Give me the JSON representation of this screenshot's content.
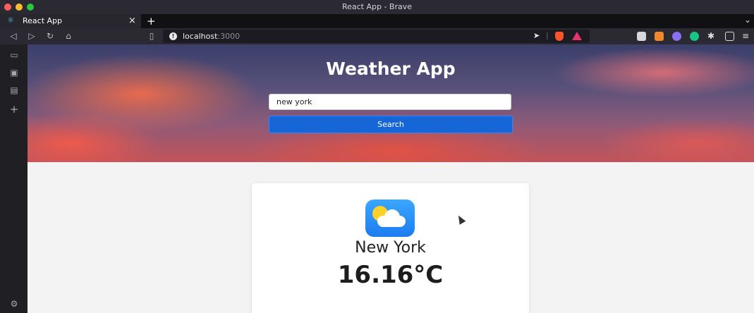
{
  "window": {
    "title": "React App - Brave"
  },
  "tabs": [
    {
      "label": "React App",
      "icon": "react-icon"
    }
  ],
  "toolbar": {
    "url_host": "localhost",
    "url_port": ":3000",
    "icons": [
      "back-icon",
      "forward-icon",
      "reload-icon",
      "home-icon",
      "bookmark-icon"
    ]
  },
  "hero": {
    "title": "Weather App",
    "search_value": "new york",
    "search_button": "Search"
  },
  "weather": {
    "city": "New York",
    "temperature": "16.16°C",
    "icon": "partly-cloudy-icon"
  },
  "colors": {
    "accent": "#1666d8",
    "brand": "#fb542b"
  }
}
